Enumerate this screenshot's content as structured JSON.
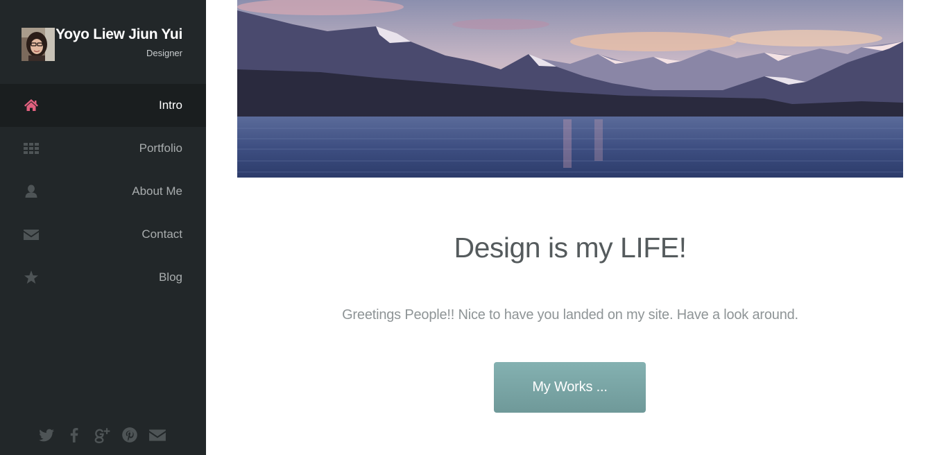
{
  "profile": {
    "name": "Yoyo Liew Jiun Yui",
    "role": "Designer"
  },
  "nav": {
    "items": [
      {
        "label": "Intro",
        "icon": "home-icon",
        "active": true
      },
      {
        "label": "Portfolio",
        "icon": "grid-icon",
        "active": false
      },
      {
        "label": "About Me",
        "icon": "user-icon",
        "active": false
      },
      {
        "label": "Contact",
        "icon": "envelope-icon",
        "active": false
      },
      {
        "label": "Blog",
        "icon": "star-icon",
        "active": false
      }
    ]
  },
  "social": [
    "twitter-icon",
    "facebook-icon",
    "google-plus-icon",
    "pinterest-icon",
    "mail-icon"
  ],
  "main": {
    "headline": "Design is my LIFE!",
    "intro": "Greetings People!! Nice to have you landed on my site. Have a look around.",
    "cta_label": "My Works ..."
  },
  "colors": {
    "sidebar_bg": "#222729",
    "active_item_bg": "#1a1e1f",
    "active_icon": "#e0607e",
    "inactive_icon": "#4e5456",
    "cta_bg": "#7aa5a5"
  }
}
